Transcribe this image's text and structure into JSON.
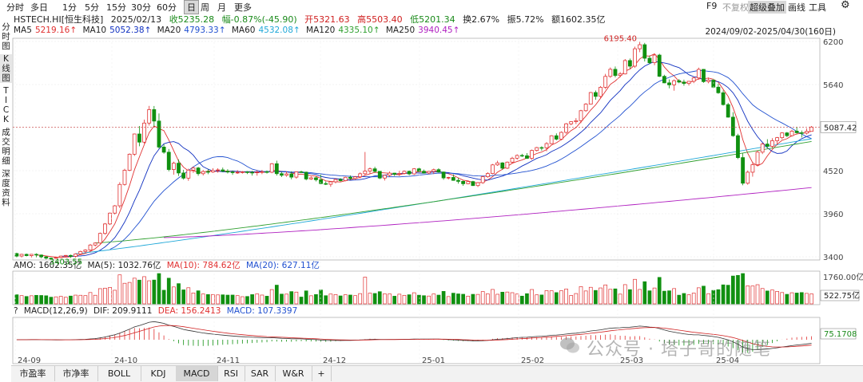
{
  "toolbar": {
    "timeframes": [
      "分时",
      "多日",
      "1分",
      "5分",
      "15分",
      "30分",
      "60分",
      "日",
      "周",
      "月",
      "更多"
    ],
    "active_index": 7,
    "right": {
      "f9": "F9",
      "no_adjust": "不复权",
      "overlay": "超级叠加",
      "draw": "画线",
      "tools": "工具"
    }
  },
  "sidenav": [
    "分时图",
    "K线图",
    "TICK",
    "成交明细",
    "深度资料"
  ],
  "info": {
    "symbol": "HSTECH.HI[恒生科技]",
    "date": "2025/02/13",
    "close": "收5235.28",
    "change": "幅-0.87%(-45.90)",
    "open": "开5321.63",
    "high": "高5503.40",
    "low": "低5201.34",
    "turnover": "换2.67%",
    "amplitude": "振5.72%",
    "amount": "额1602.35亿"
  },
  "ma": {
    "ma5_label": "MA5",
    "ma5": "5219.16↑",
    "ma10_label": "MA10",
    "ma10": "5052.38↑",
    "ma20_label": "MA20",
    "ma20": "4793.33↑",
    "ma60_label": "MA60",
    "ma60": "4532.08↑",
    "ma120_label": "MA120",
    "ma120": "4335.10↑",
    "ma250_label": "MA250",
    "ma250": "3940.45↑"
  },
  "range_text": "2024/09/02-2025/04/30(160日)",
  "colors": {
    "up": "#e03030",
    "down": "#109010",
    "ma5": "#e03030",
    "ma10": "#1030c0",
    "ma20": "#2050d0",
    "ma60": "#20a8d8",
    "ma120": "#30a030",
    "ma250": "#b020c0"
  },
  "annotations": {
    "high": "6195.40",
    "low": "3403.55",
    "current": "5087.42"
  },
  "amo": {
    "label": "AMO: 1602.35亿",
    "ma5": "MA(5): 1032.76亿",
    "ma10": "MA(10): 784.62亿",
    "ma20": "MA(20): 627.11亿",
    "axis_top": "1760.00亿",
    "current": "522.75亿"
  },
  "macd": {
    "q": "?",
    "label": "MACD(12,26,9)",
    "dif": "DIF: 209.9111",
    "dea": "DEA: 156.2413",
    "macd": "MACD: 107.3397",
    "current": "75.1708"
  },
  "watermark": "公众号 · 塔子哥的随笔",
  "bottom_tabs": [
    "市盈率",
    "市净率",
    "BOLL",
    "KDJ",
    "MACD",
    "RSI",
    "SAR",
    "W&R",
    "+"
  ],
  "bottom_active": 4,
  "chart_data": {
    "type": "candlestick",
    "ylim": [
      3400,
      6200
    ],
    "yticks": [
      "6200",
      "5640",
      "5080",
      "4520",
      "3960",
      "3400"
    ],
    "xticks": [
      "24-09",
      "24-10",
      "24-11",
      "24-12",
      "25-01",
      "25-02",
      "25-03",
      "25-04"
    ],
    "candles": [
      [
        3442,
        3453,
        3393,
        3409
      ],
      [
        3410,
        3439,
        3391,
        3432
      ],
      [
        3432,
        3442,
        3406,
        3415
      ],
      [
        3415,
        3437,
        3391,
        3432
      ],
      [
        3432,
        3445,
        3393,
        3423
      ],
      [
        3423,
        3430,
        3380,
        3399
      ],
      [
        3399,
        3411,
        3365,
        3382
      ],
      [
        3382,
        3392,
        3366,
        3381
      ],
      [
        3381,
        3404,
        3373,
        3391
      ],
      [
        3391,
        3416,
        3378,
        3409
      ],
      [
        3409,
        3423,
        3398,
        3418
      ],
      [
        3418,
        3428,
        3386,
        3406
      ],
      [
        3406,
        3445,
        3390,
        3437
      ],
      [
        3437,
        3479,
        3426,
        3469
      ],
      [
        3469,
        3499,
        3451,
        3488
      ],
      [
        3488,
        3567,
        3476,
        3553
      ],
      [
        3553,
        3587,
        3534,
        3579
      ],
      [
        3579,
        3715,
        3570,
        3704
      ],
      [
        3704,
        3838,
        3686,
        3827
      ],
      [
        3827,
        3976,
        3814,
        3968
      ],
      [
        3968,
        4073,
        3950,
        4063
      ],
      [
        4063,
        4370,
        4033,
        4341
      ],
      [
        4341,
        4545,
        4325,
        4525
      ],
      [
        4525,
        4745,
        4513,
        4734
      ],
      [
        4734,
        5003,
        4712,
        4997
      ],
      [
        4997,
        5101,
        4837,
        4891
      ],
      [
        4891,
        5184,
        4872,
        5139
      ],
      [
        5139,
        5362,
        5107,
        5314
      ],
      [
        5314,
        5361,
        5096,
        5165
      ],
      [
        5165,
        5264,
        4808,
        4827
      ],
      [
        4827,
        4863,
        4740,
        4760
      ],
      [
        4760,
        4802,
        4511,
        4535
      ],
      [
        4535,
        4637,
        4468,
        4617
      ],
      [
        4617,
        4666,
        4451,
        4490
      ],
      [
        4490,
        4531,
        4403,
        4423
      ],
      [
        4423,
        4546,
        4388,
        4527
      ],
      [
        4527,
        4576,
        4491,
        4555
      ],
      [
        4555,
        4569,
        4454,
        4481
      ],
      [
        4481,
        4529,
        4458,
        4508
      ],
      [
        4508,
        4537,
        4474,
        4503
      ],
      [
        4503,
        4553,
        4490,
        4523
      ],
      [
        4523,
        4552,
        4494,
        4530
      ],
      [
        4530,
        4560,
        4501,
        4513
      ],
      [
        4513,
        4539,
        4484,
        4502
      ],
      [
        4502,
        4522,
        4466,
        4495
      ],
      [
        4495,
        4526,
        4478,
        4498
      ],
      [
        4498,
        4515,
        4482,
        4504
      ],
      [
        4504,
        4512,
        4476,
        4498
      ],
      [
        4498,
        4518,
        4456,
        4495
      ],
      [
        4495,
        4527,
        4455,
        4501
      ],
      [
        4501,
        4531,
        4475,
        4506
      ],
      [
        4506,
        4523,
        4483,
        4500
      ],
      [
        4500,
        4619,
        4487,
        4610
      ],
      [
        4610,
        4650,
        4456,
        4481
      ],
      [
        4481,
        4506,
        4437,
        4460
      ],
      [
        4460,
        4510,
        4441,
        4478
      ],
      [
        4478,
        4511,
        4407,
        4436
      ],
      [
        4436,
        4512,
        4415,
        4505
      ],
      [
        4505,
        4519,
        4491,
        4500
      ],
      [
        4500,
        4508,
        4394,
        4412
      ],
      [
        4412,
        4446,
        4400,
        4427
      ],
      [
        4427,
        4443,
        4380,
        4402
      ],
      [
        4402,
        4471,
        4345,
        4352
      ],
      [
        4352,
        4380,
        4333,
        4343
      ],
      [
        4343,
        4380,
        4310,
        4375
      ],
      [
        4375,
        4417,
        4354,
        4406
      ],
      [
        4406,
        4423,
        4379,
        4390
      ],
      [
        4390,
        4441,
        4381,
        4434
      ],
      [
        4434,
        4458,
        4402,
        4418
      ],
      [
        4418,
        4450,
        4402,
        4440
      ],
      [
        4440,
        4497,
        4421,
        4480
      ],
      [
        4480,
        4763,
        4458,
        4515
      ],
      [
        4515,
        4561,
        4479,
        4544
      ],
      [
        4544,
        4571,
        4493,
        4511
      ],
      [
        4511,
        4513,
        4410,
        4424
      ],
      [
        4424,
        4465,
        4392,
        4460
      ],
      [
        4460,
        4510,
        4439,
        4488
      ],
      [
        4488,
        4491,
        4451,
        4473
      ],
      [
        4473,
        4518,
        4450,
        4484
      ],
      [
        4484,
        4522,
        4470,
        4512
      ],
      [
        4512,
        4521,
        4461,
        4478
      ],
      [
        4478,
        4553,
        4465,
        4544
      ],
      [
        4544,
        4557,
        4503,
        4512
      ],
      [
        4512,
        4534,
        4487,
        4489
      ],
      [
        4489,
        4516,
        4474,
        4510
      ],
      [
        4510,
        4547,
        4476,
        4533
      ],
      [
        4533,
        4551,
        4496,
        4502
      ],
      [
        4502,
        4509,
        4402,
        4426
      ],
      [
        4426,
        4440,
        4405,
        4432
      ],
      [
        4432,
        4471,
        4389,
        4394
      ],
      [
        4394,
        4424,
        4352,
        4381
      ],
      [
        4381,
        4390,
        4323,
        4350
      ],
      [
        4350,
        4385,
        4344,
        4378
      ],
      [
        4378,
        4388,
        4322,
        4326
      ],
      [
        4326,
        4372,
        4307,
        4364
      ],
      [
        4364,
        4453,
        4348,
        4441
      ],
      [
        4441,
        4500,
        4427,
        4483
      ],
      [
        4483,
        4607,
        4473,
        4595
      ],
      [
        4595,
        4649,
        4582,
        4621
      ],
      [
        4621,
        4630,
        4534,
        4552
      ],
      [
        4552,
        4639,
        4541,
        4631
      ],
      [
        4631,
        4700,
        4611,
        4682
      ],
      [
        4682,
        4732,
        4662,
        4718
      ],
      [
        4718,
        4739,
        4698,
        4714
      ],
      [
        4714,
        4748,
        4673,
        4680
      ],
      [
        4680,
        4794,
        4661,
        4783
      ],
      [
        4783,
        4829,
        4770,
        4820
      ],
      [
        4820,
        4837,
        4780,
        4817
      ],
      [
        4817,
        4891,
        4773,
        4872
      ],
      [
        4872,
        4981,
        4865,
        4974
      ],
      [
        4974,
        5005,
        4915,
        4930
      ],
      [
        4930,
        5031,
        4915,
        5018
      ],
      [
        5018,
        5139,
        4999,
        5129
      ],
      [
        5129,
        5161,
        5111,
        5157
      ],
      [
        5157,
        5203,
        5126,
        5170
      ],
      [
        5170,
        5311,
        5138,
        5300
      ],
      [
        5300,
        5398,
        5285,
        5385
      ],
      [
        5385,
        5543,
        5379,
        5536
      ],
      [
        5536,
        5562,
        5442,
        5486
      ],
      [
        5486,
        5620,
        5465,
        5604
      ],
      [
        5604,
        5779,
        5582,
        5746
      ],
      [
        5746,
        5862,
        5726,
        5838
      ],
      [
        5838,
        5875,
        5733,
        5758
      ],
      [
        5758,
        5803,
        5734,
        5778
      ],
      [
        5778,
        5972,
        5771,
        5952
      ],
      [
        5952,
        5978,
        5847,
        5879
      ],
      [
        5879,
        6132,
        5857,
        6105
      ],
      [
        6105,
        6195,
        6061,
        6158
      ],
      [
        6158,
        6182,
        5940,
        5982
      ],
      [
        5982,
        6019,
        5904,
        5924
      ],
      [
        5924,
        6045,
        5891,
        6023
      ],
      [
        6023,
        6040,
        5738,
        5747
      ],
      [
        5747,
        5767,
        5657,
        5662
      ],
      [
        5662,
        5706,
        5591,
        5636
      ],
      [
        5636,
        5706,
        5560,
        5690
      ],
      [
        5690,
        5711,
        5657,
        5672
      ],
      [
        5672,
        5703,
        5625,
        5654
      ],
      [
        5654,
        5687,
        5627,
        5682
      ],
      [
        5682,
        5741,
        5658,
        5726
      ],
      [
        5726,
        5860,
        5703,
        5837
      ],
      [
        5837,
        5842,
        5662,
        5678
      ],
      [
        5678,
        5731,
        5656,
        5697
      ],
      [
        5697,
        5716,
        5595,
        5606
      ],
      [
        5606,
        5650,
        5519,
        5533
      ],
      [
        5533,
        5564,
        5366,
        5379
      ],
      [
        5379,
        5402,
        5209,
        5216
      ],
      [
        5216,
        5281,
        4960,
        4975
      ],
      [
        4975,
        5000,
        4670,
        4690
      ],
      [
        4690,
        4746,
        4330,
        4357
      ],
      [
        4357,
        4522,
        4337,
        4500
      ],
      [
        4500,
        4624,
        4442,
        4597
      ],
      [
        4597,
        4785,
        4585,
        4761
      ],
      [
        4761,
        4883,
        4736,
        4866
      ],
      [
        4866,
        4929,
        4816,
        4837
      ],
      [
        4837,
        4942,
        4816,
        4909
      ],
      [
        4909,
        4958,
        4851,
        4949
      ],
      [
        4949,
        5019,
        4928,
        5011
      ],
      [
        5011,
        5023,
        4957,
        4975
      ],
      [
        4975,
        5051,
        4963,
        5034
      ],
      [
        5034,
        5085,
        5001,
        5013
      ],
      [
        5013,
        5042,
        4951,
        5008
      ],
      [
        5008,
        5070,
        4991,
        5031
      ],
      [
        5031,
        5101,
        5029,
        5087
      ]
    ]
  }
}
